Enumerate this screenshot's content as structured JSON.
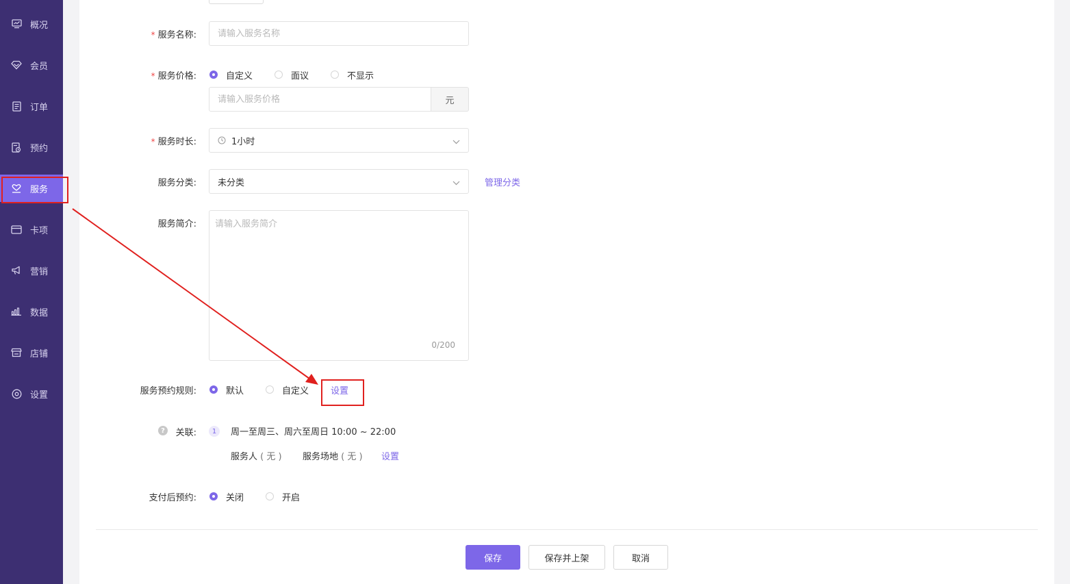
{
  "sidebar": {
    "items": [
      {
        "label": "概况",
        "icon": "overview-chart-icon"
      },
      {
        "label": "会员",
        "icon": "diamond-icon"
      },
      {
        "label": "订单",
        "icon": "order-list-icon"
      },
      {
        "label": "预约",
        "icon": "appointment-icon"
      },
      {
        "label": "服务",
        "icon": "service-heart-icon",
        "active": true
      },
      {
        "label": "卡项",
        "icon": "card-icon"
      },
      {
        "label": "营销",
        "icon": "megaphone-icon"
      },
      {
        "label": "数据",
        "icon": "bar-chart-icon"
      },
      {
        "label": "店铺",
        "icon": "store-icon"
      },
      {
        "label": "设置",
        "icon": "settings-icon"
      }
    ],
    "active_color": "#7d67e8",
    "bg_color": "#3d2f72"
  },
  "form": {
    "name": {
      "label": "服务名称:",
      "placeholder": "请输入服务名称",
      "required": "*"
    },
    "price": {
      "label": "服务价格:",
      "required": "*",
      "options": [
        "自定义",
        "面议",
        "不显示"
      ],
      "selected": "自定义",
      "placeholder": "请输入服务价格",
      "unit": "元"
    },
    "duration": {
      "label": "服务时长:",
      "required": "*",
      "value": "1小时"
    },
    "category": {
      "label": "服务分类:",
      "value": "未分类",
      "manage_link": "管理分类"
    },
    "intro": {
      "label": "服务简介:",
      "placeholder": "请输入服务简介",
      "counter": "0/200"
    },
    "booking_rule": {
      "label": "服务预约规则:",
      "options": [
        "默认",
        "自定义"
      ],
      "selected": "默认",
      "settings_link": "设置"
    },
    "relation": {
      "label": "关联:",
      "help": "?",
      "index": "1",
      "schedule": "周一至周三、周六至周日 10:00 ~ 22:00",
      "staff_label": "服务人",
      "staff_value": "( 无 )",
      "venue_label": "服务场地",
      "venue_value": "( 无 )",
      "settings_link": "设置"
    },
    "pay_booking": {
      "label": "支付后预约:",
      "options": [
        "关闭",
        "开启"
      ],
      "selected": "关闭"
    }
  },
  "actions": {
    "save": "保存",
    "save_publish": "保存并上架",
    "cancel": "取消"
  },
  "annotation_color": "#e0201e"
}
